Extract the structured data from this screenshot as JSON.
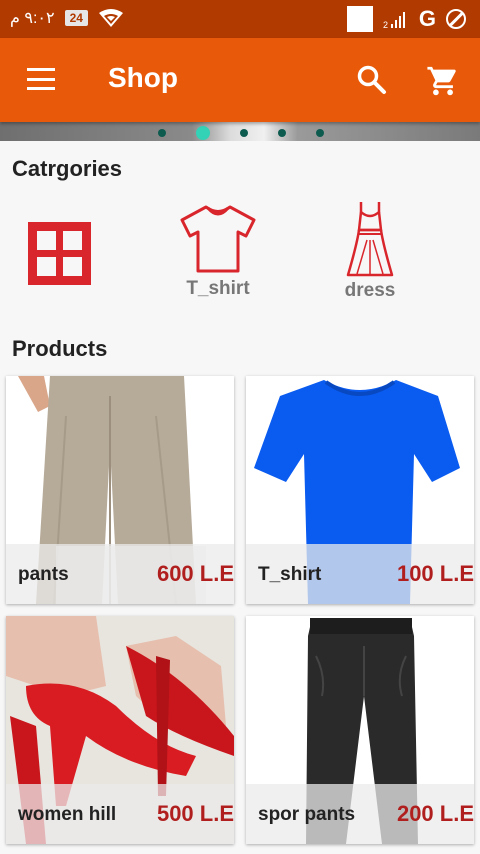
{
  "status_bar": {
    "time": "٩:٠٢ م",
    "battery": "24"
  },
  "app_bar": {
    "title": "Shop"
  },
  "banner": {
    "dot_count": 5,
    "active_dot": 1
  },
  "categories": {
    "title": "Catrgories",
    "items": [
      {
        "label": "",
        "icon": "grid-icon"
      },
      {
        "label": "T_shirt",
        "icon": "tshirt-icon"
      },
      {
        "label": "dress",
        "icon": "dress-icon"
      }
    ]
  },
  "products": {
    "title": "Products",
    "items": [
      {
        "name": "pants",
        "price": "600 L.E"
      },
      {
        "name": "T_shirt",
        "price": "100 L.E"
      },
      {
        "name": "women hill",
        "price": "500 L.E"
      },
      {
        "name": "spor pants",
        "price": "200 L.E"
      }
    ]
  },
  "colors": {
    "status_bar": "#b13a00",
    "app_bar": "#e85a0a",
    "price": "#b01e1e",
    "category_icon": "#d9262c"
  }
}
